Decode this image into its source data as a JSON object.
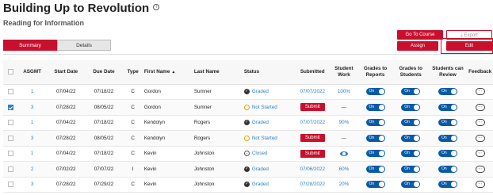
{
  "header": {
    "title": "Building Up to Revolution",
    "info_icon": "i",
    "subtitle": "Reading for Information"
  },
  "tabs": [
    {
      "label": "Summary",
      "active": true
    },
    {
      "label": "Details",
      "active": false
    }
  ],
  "actions": {
    "goto_course": "Go To Course",
    "export": "Export",
    "assign": "Assign",
    "edit": "Edit"
  },
  "table": {
    "headers": {
      "asgmt": "ASGMT",
      "start_date": "Start Date",
      "due_date": "Due Date",
      "type": "Type",
      "first_name": "First Name",
      "last_name": "Last Name",
      "status": "Status",
      "submitted": "Submitted",
      "student_work": "Student Work",
      "grades_reports": "Grades to Reports",
      "grades_students": "Grades to Students",
      "students_review": "Students can Review",
      "feedback": "Feedback"
    },
    "toggle_label": "On",
    "submit_label": "Submit",
    "rows": [
      {
        "checked": false,
        "asgmt": "1",
        "start": "07/04/22",
        "due": "07/18/22",
        "type": "C",
        "first": "Gordon",
        "last": "Sumner",
        "status": "Graded",
        "status_kind": "graded",
        "submitted": "07/07/2022",
        "work": "100%",
        "work_kind": "text"
      },
      {
        "checked": true,
        "asgmt": "3",
        "start": "07/28/22",
        "due": "08/05/22",
        "type": "C",
        "first": "Gordon",
        "last": "Sumner",
        "status": "Not Started",
        "status_kind": "notstarted",
        "submitted": "",
        "work": "—",
        "work_kind": "dash"
      },
      {
        "checked": false,
        "asgmt": "1",
        "start": "07/04/22",
        "due": "07/18/22",
        "type": "C",
        "first": "Kendolyn",
        "last": "Rogers",
        "status": "Graded",
        "status_kind": "graded",
        "submitted": "07/07/2022",
        "work": "90%",
        "work_kind": "text"
      },
      {
        "checked": false,
        "asgmt": "3",
        "start": "07/28/22",
        "due": "08/05/22",
        "type": "C",
        "first": "Kendolyn",
        "last": "Rogers",
        "status": "Not Started",
        "status_kind": "notstarted",
        "submitted": "",
        "work": "—",
        "work_kind": "dash"
      },
      {
        "checked": false,
        "asgmt": "1",
        "start": "07/04/22",
        "due": "07/18/22",
        "type": "C",
        "first": "Kevin",
        "last": "Johnston",
        "status": "Closed",
        "status_kind": "closed",
        "submitted": "",
        "work": "",
        "work_kind": "eye"
      },
      {
        "checked": false,
        "asgmt": "2",
        "start": "07/02/22",
        "due": "07/07/22",
        "type": "I",
        "first": "Kevin",
        "last": "Johnston",
        "status": "Graded",
        "status_kind": "graded",
        "submitted": "07/06/2022",
        "work": "60%",
        "work_kind": "text"
      },
      {
        "checked": false,
        "asgmt": "3",
        "start": "07/28/22",
        "due": "07/29/22",
        "type": "C",
        "first": "Kevin",
        "last": "Johnston",
        "status": "Graded",
        "status_kind": "graded",
        "submitted": "07/28/2022",
        "work": "20%",
        "work_kind": "text"
      }
    ]
  },
  "colors": {
    "accent": "#c8102e",
    "link": "#2f80c0",
    "toggle": "#0a5aa8"
  }
}
